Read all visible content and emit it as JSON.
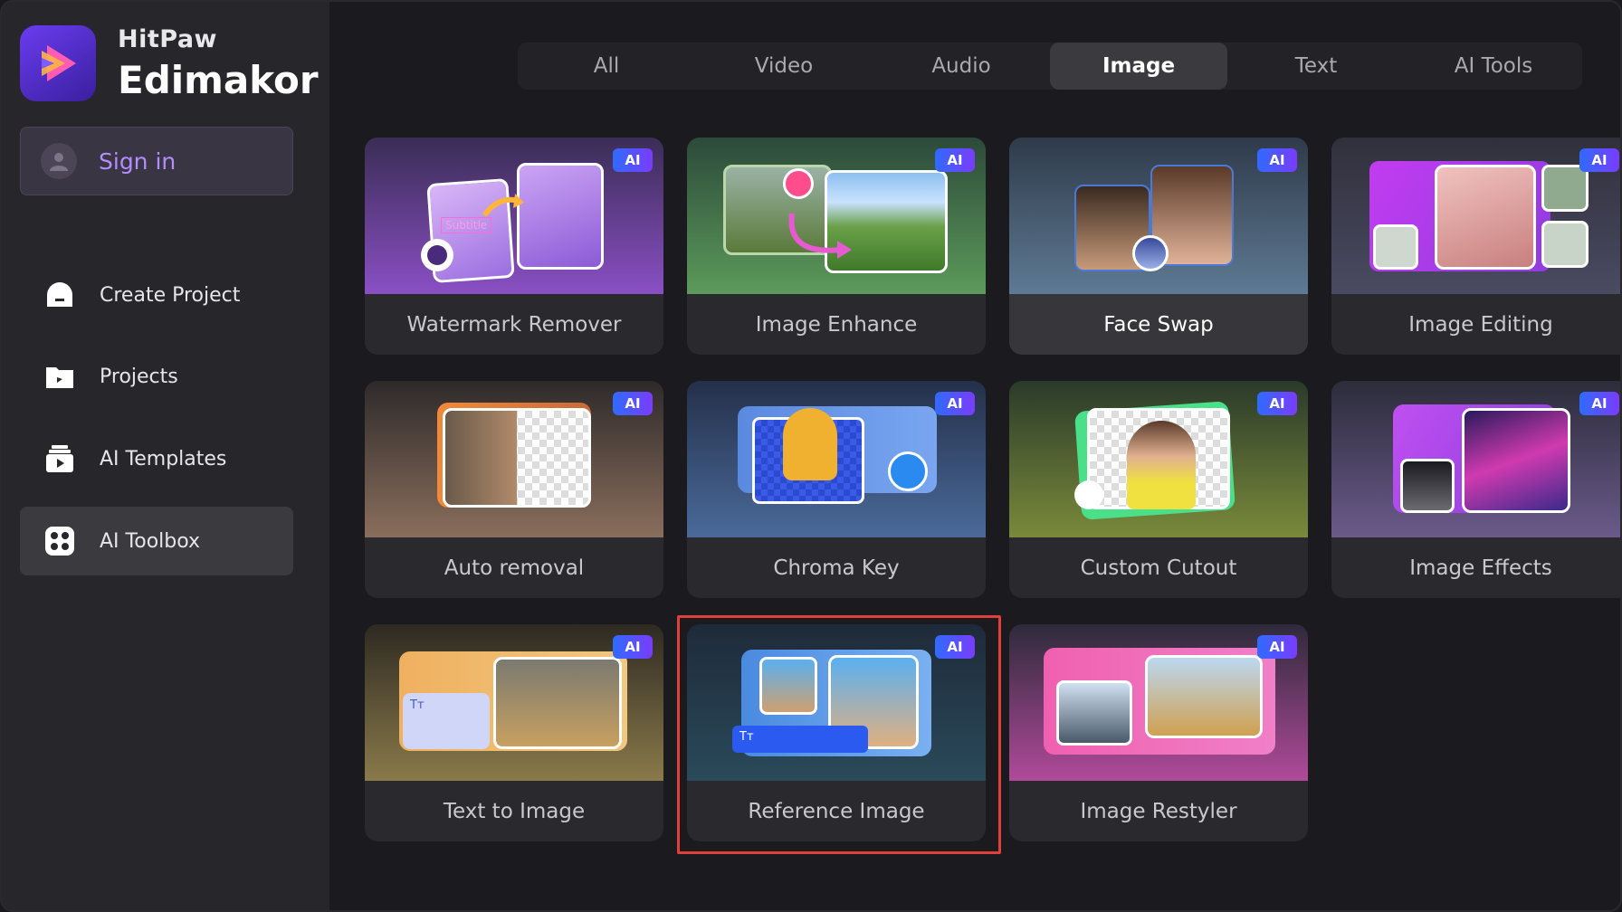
{
  "brand": {
    "small": "HitPaw",
    "big": "Edimakor"
  },
  "sidebar": {
    "sign_in": "Sign in",
    "items": [
      {
        "label": "Create Project",
        "icon": "create-project-icon",
        "active": false
      },
      {
        "label": "Projects",
        "icon": "projects-folder-icon",
        "active": false
      },
      {
        "label": "AI Templates",
        "icon": "ai-templates-icon",
        "active": false
      },
      {
        "label": "AI Toolbox",
        "icon": "ai-toolbox-icon",
        "active": true
      }
    ]
  },
  "tabs": [
    {
      "label": "All",
      "active": false
    },
    {
      "label": "Video",
      "active": false
    },
    {
      "label": "Audio",
      "active": false
    },
    {
      "label": "Image",
      "active": true
    },
    {
      "label": "Text",
      "active": false
    },
    {
      "label": "AI Tools",
      "active": false
    }
  ],
  "badge_label": "AI",
  "cards": [
    {
      "title": "Watermark Remover"
    },
    {
      "title": "Image Enhance"
    },
    {
      "title": "Face Swap"
    },
    {
      "title": "Image Editing"
    },
    {
      "title": "Auto removal"
    },
    {
      "title": "Chroma Key"
    },
    {
      "title": "Custom Cutout"
    },
    {
      "title": "Image Effects"
    },
    {
      "title": "Text to Image"
    },
    {
      "title": "Reference Image"
    },
    {
      "title": "Image Restyler"
    }
  ],
  "thumb_texts": {
    "subtitle": "Subtitle",
    "text_icon": "Tт"
  },
  "colors": {
    "accent": "#b38cff",
    "badge_start": "#2f6bff",
    "badge_end": "#7a3cff",
    "highlight": "#e0403a"
  }
}
